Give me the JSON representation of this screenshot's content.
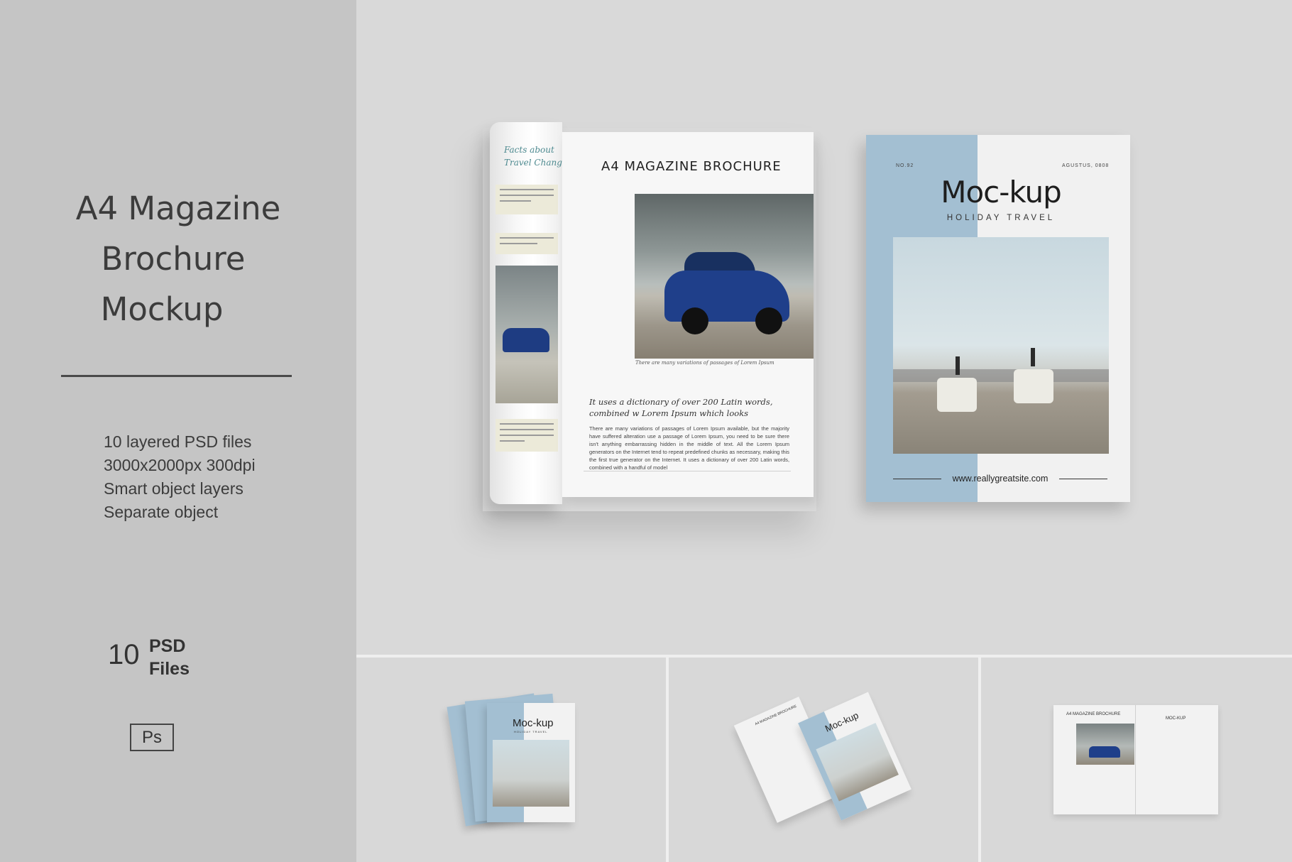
{
  "left_panel": {
    "title_lines": [
      "A4 Magazine",
      "Brochure",
      "Mockup"
    ],
    "features": [
      "10 layered PSD files",
      "3000x2000px 300dpi",
      "Smart object layers",
      "Separate object"
    ],
    "psd_count": "10",
    "psd_label_line1": "PSD",
    "psd_label_line2": "Files",
    "badge": "Ps"
  },
  "spread": {
    "roll_heading_line1": "Facts about",
    "roll_heading_line2": "Travel Changes",
    "title": "A4 MAGAZINE BROCHURE",
    "caption": "There are many variations of passages of Lorem Ipsum",
    "quote": "It uses a dictionary of over 200 Latin words, combined w Lorem Ipsum which looks",
    "body": "There are many variations of passages of Lorem Ipsum available, but the majority have suffered alteration use a passage of Lorem Ipsum, you need to be sure there isn't anything embarrassing hidden in the middle of text. All the Lorem Ipsum generators on the Internet tend to repeat predefined chunks as necessary, making this the first true generator on the Internet. It uses a dictionary of over 200 Latin words, combined with a handful of model"
  },
  "cover": {
    "issue": "NO.92",
    "date": "AGUSTUS, 0808",
    "title": "Moc-kup",
    "subtitle": "HOLIDAY TRAVEL",
    "url": "www.reallygreatsite.com"
  },
  "thumbnails": {
    "cover_title": "Moc-kup",
    "cover_sub": "HOLIDAY TRAVEL",
    "spread_title": "A4 MAGAZINE BROCHURE",
    "spread_right_title": "MOC-KUP"
  },
  "colors": {
    "accent_blue": "#a3bfd2",
    "left_bg": "#c5c5c5",
    "scene_bg": "#d9d9d9",
    "car_blue": "#1f3f8a"
  }
}
